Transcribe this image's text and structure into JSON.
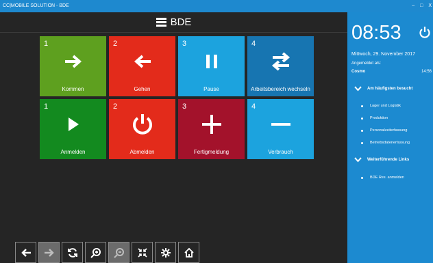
{
  "window": {
    "title": "CC|MOBILE SOLUTION - BDE",
    "min": "–",
    "max": "□",
    "close": "X"
  },
  "header": {
    "title": "BDE"
  },
  "tiles": [
    {
      "num": "1",
      "label": "Kommen",
      "color": "#5ea01f",
      "icon": "arrow-right-icon"
    },
    {
      "num": "2",
      "label": "Gehen",
      "color": "#e32b1b",
      "icon": "arrow-left-icon"
    },
    {
      "num": "3",
      "label": "Pause",
      "color": "#1ca3de",
      "icon": "pause-icon"
    },
    {
      "num": "4",
      "label": "Arbeitsbereich wechseln",
      "color": "#1775b1",
      "icon": "swap-arrows-icon"
    },
    {
      "num": "1",
      "label": "Anmelden",
      "color": "#138a1f",
      "icon": "play-icon"
    },
    {
      "num": "2",
      "label": "Abmelden",
      "color": "#e32b1b",
      "icon": "power-icon"
    },
    {
      "num": "3",
      "label": "Fertigmeldung",
      "color": "#a3122b",
      "icon": "plus-icon"
    },
    {
      "num": "4",
      "label": "Verbrauch",
      "color": "#1ca3de",
      "icon": "minus-icon"
    }
  ],
  "toolbar": [
    {
      "name": "back-button",
      "icon": "arrow-left-icon",
      "disabled": false
    },
    {
      "name": "forward-button",
      "icon": "arrow-right-icon",
      "disabled": true
    },
    {
      "name": "refresh-button",
      "icon": "refresh-icon",
      "disabled": false
    },
    {
      "name": "zoom-in-button",
      "icon": "zoom-in-icon",
      "disabled": false
    },
    {
      "name": "zoom-out-button",
      "icon": "zoom-out-icon",
      "disabled": true
    },
    {
      "name": "collapse-button",
      "icon": "collapse-icon",
      "disabled": false
    },
    {
      "name": "settings-button",
      "icon": "gear-icon",
      "disabled": false
    },
    {
      "name": "home-button",
      "icon": "home-icon",
      "disabled": false
    }
  ],
  "sidebar": {
    "time": "08:53",
    "date": "Mittwoch, 29. November 2017",
    "logged_in_label": "Angemeldet als:",
    "user": "Cosmo",
    "user_time": "14:56",
    "section1": "Am häufigsten besucht",
    "items1": [
      "Lager und Logistik",
      "Produktion",
      "Personalzeiterfassung",
      "Betriebsdatenerfassung"
    ],
    "section2": "Weiterführende Links",
    "items2": [
      "BDE Res. anmelden"
    ]
  }
}
